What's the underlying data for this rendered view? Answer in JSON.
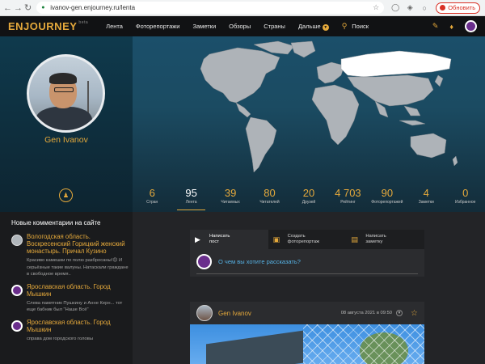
{
  "browser": {
    "url": "ivanov-gen.enjourney.ru/lenta",
    "reload_label": "Обновить"
  },
  "nav": {
    "logo": "ENJOURNEY",
    "beta": "beta",
    "items": [
      "Лента",
      "Фоторепортажи",
      "Заметки",
      "Обзоры",
      "Страны",
      "Дальше"
    ],
    "search_label": "Поиск"
  },
  "profile": {
    "name": "Gen Ivanov"
  },
  "stats": [
    {
      "num": "6",
      "label": "Стран",
      "active": false
    },
    {
      "num": "95",
      "label": "Лента",
      "active": true
    },
    {
      "num": "39",
      "label": "Читаемых",
      "active": false
    },
    {
      "num": "80",
      "label": "Читателей",
      "active": false
    },
    {
      "num": "20",
      "label": "Друзей",
      "active": false
    },
    {
      "num": "4 703",
      "label": "Рейтинг",
      "active": false
    },
    {
      "num": "90",
      "label": "Фоторепортажей",
      "active": false
    },
    {
      "num": "4",
      "label": "Заметки",
      "active": false
    },
    {
      "num": "0",
      "label": "Избранное",
      "active": false
    }
  ],
  "sidebar": {
    "title": "Новые комментарии на сайте",
    "comments": [
      {
        "title": "Вологодская область. Воскресенский Горицкий женский монастырь. Причал Кузино",
        "text": "Красиво камешки по полю разбросаны!😊 И серьёзные такие валуны. Натаскали граждане в свободное время..",
        "avatar": "gray"
      },
      {
        "title": "Ярославская область. Город Мышкин",
        "text": "Слева памятник Пушкину и Анне Керн... тот еще бабник был \"Наше Всё\"",
        "avatar": "purple"
      },
      {
        "title": "Ярославская область. Город Мышкин",
        "text": "справа дом городского головы",
        "avatar": "purple"
      }
    ]
  },
  "composer": {
    "tabs": [
      {
        "l1": "Написать",
        "l2": "пост",
        "icon": "megaphone-icon"
      },
      {
        "l1": "Создать",
        "l2": "фоторепортаж",
        "icon": "photo-icon"
      },
      {
        "l1": "Написать",
        "l2": "заметку",
        "icon": "note-icon"
      }
    ],
    "question": "О чем вы хотите рассказать?"
  },
  "post": {
    "author": "Gen Ivanov",
    "date": "08 августа 2021 в 09:50"
  },
  "colors": {
    "accent": "#e5a93b",
    "link": "#56b3e6",
    "land": "#aeb3b8",
    "visited": "#ffffff"
  }
}
